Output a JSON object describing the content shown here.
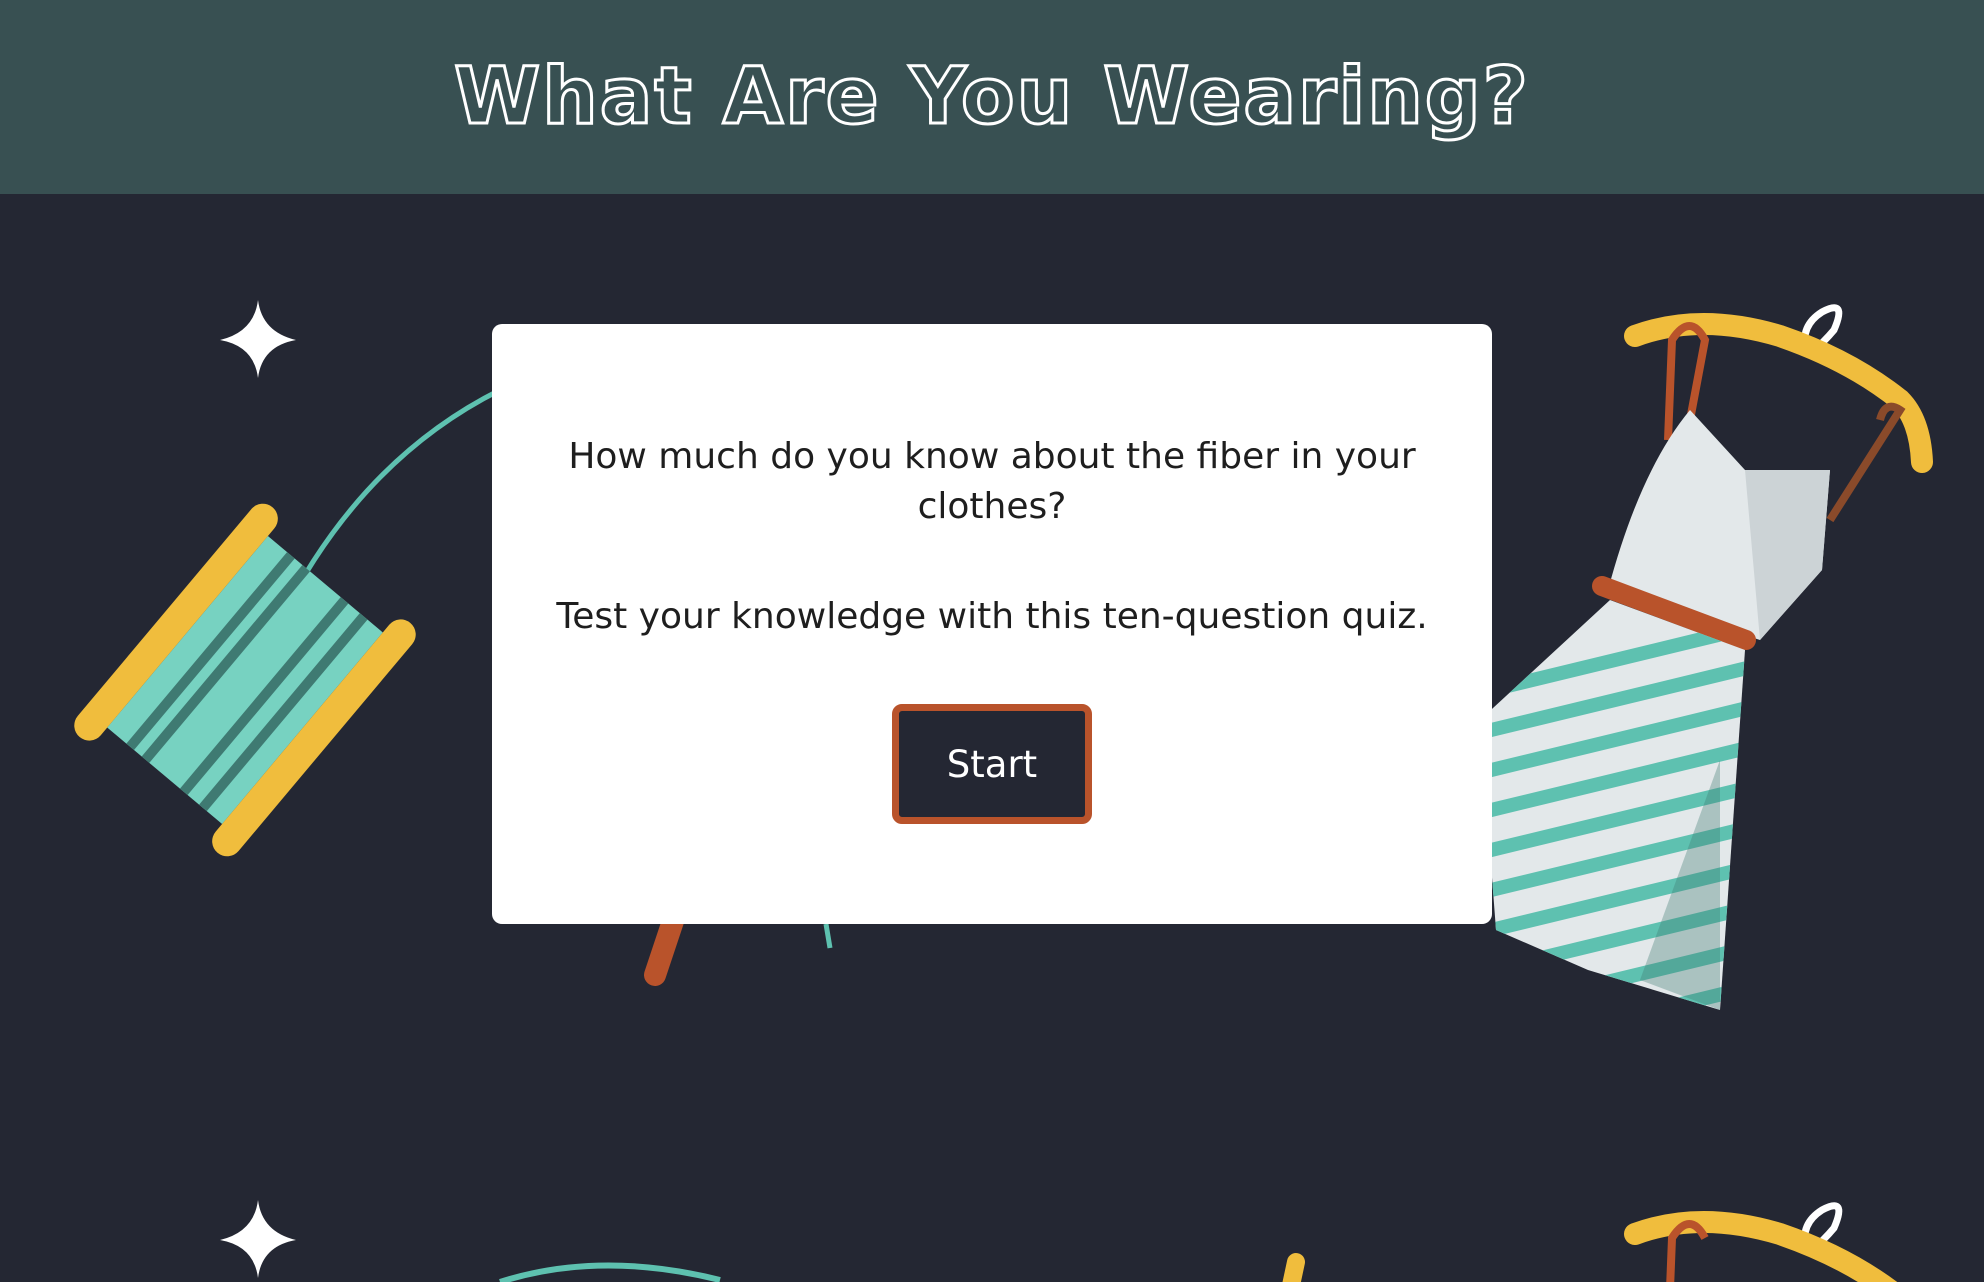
{
  "header": {
    "title": "What Are You Wearing?"
  },
  "quiz": {
    "question": "How much do you know about the fiber in your clothes?",
    "subtitle": "Test your knowledge with this ten-question quiz.",
    "start_label": "Start"
  },
  "decorations": {
    "icons": [
      "sparkle-icon",
      "thread-spool-icon",
      "dress-on-hanger-icon",
      "knitting-needle-icon"
    ]
  },
  "colors": {
    "header_bg": "#385052",
    "page_bg": "#242733",
    "card_bg": "#ffffff",
    "accent_orange": "#b9532b",
    "spool_yellow": "#f0bd3d",
    "thread_teal": "#5ec1b0"
  }
}
